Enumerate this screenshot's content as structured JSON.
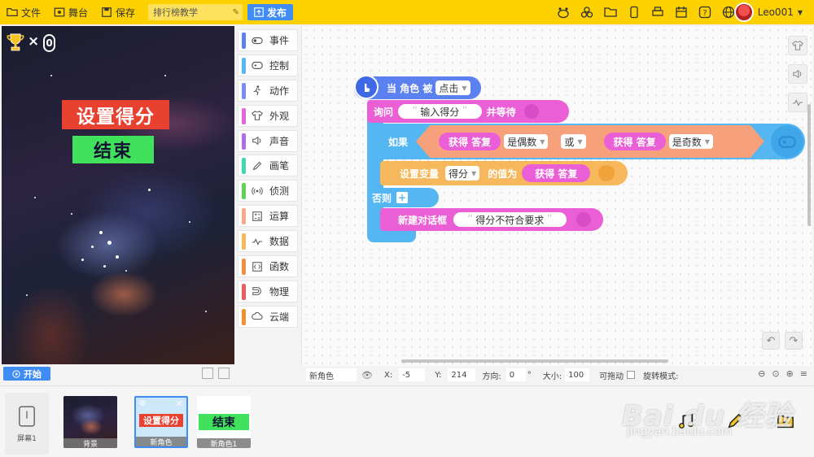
{
  "topbar": {
    "file_label": "文件",
    "stage_label": "舞台",
    "save_label": "保存",
    "project_name": "排行榜教学",
    "publish_label": "发布",
    "username": "Leo001",
    "bg_color": "#fdd000"
  },
  "stage": {
    "score_count": "0",
    "times_symbol": "×",
    "sprite_title": "设置得分",
    "sprite_end": "结束",
    "start_label": "开始"
  },
  "categories": [
    {
      "label": "事件",
      "color": "#5b80f0",
      "icon": "toggle-icon"
    },
    {
      "label": "控制",
      "color": "#55b7f2",
      "icon": "gamepad-icon"
    },
    {
      "label": "动作",
      "color": "#7a8df2",
      "icon": "runner-icon"
    },
    {
      "label": "外观",
      "color": "#e964d6",
      "icon": "shirt-icon"
    },
    {
      "label": "声音",
      "color": "#b16be8",
      "icon": "speaker-icon"
    },
    {
      "label": "画笔",
      "color": "#42d6b1",
      "icon": "pen-icon"
    },
    {
      "label": "侦测",
      "color": "#5ed456",
      "icon": "signal-icon"
    },
    {
      "label": "运算",
      "color": "#f7a98a",
      "icon": "calculator-icon"
    },
    {
      "label": "数据",
      "color": "#f6b85a",
      "icon": "data-icon"
    },
    {
      "label": "函数",
      "color": "#f2904a",
      "icon": "function-icon"
    },
    {
      "label": "物理",
      "color": "#f05b5b",
      "icon": "magnet-icon"
    },
    {
      "label": "云端",
      "color": "#f2902f",
      "icon": "cloud-icon"
    }
  ],
  "blocks": {
    "hat_label": "当 角色 被",
    "hat_dd": "点击",
    "ask_label": "询问",
    "ask_text": "输入得分",
    "ask_suffix": "并等待",
    "if_label": "如果",
    "get_answer_1": "获得 答复",
    "is_even": "是偶数",
    "or_label": "或",
    "get_answer_2": "获得 答复",
    "is_odd": "是奇数",
    "set_var_label": "设置变量",
    "var_name": "得分",
    "value_label": "的值为",
    "get_answer_3": "获得 答复",
    "else_label": "否则",
    "plus_symbol": "+",
    "dialog_label": "新建对话框",
    "dialog_text": "得分不符合要求",
    "colors": {
      "event": "#5b80f0",
      "look": "#ea5fd6",
      "control": "#55b7f2",
      "data": "#f6b85a"
    }
  },
  "props": {
    "sprite_name": "新角色",
    "x_label": "X:",
    "x_value": "-5",
    "y_label": "Y:",
    "y_value": "214",
    "dir_label": "方向:",
    "dir_value": "0",
    "deg_symbol": "°",
    "size_label": "大小:",
    "size_value": "100",
    "draggable_label": "可拖动",
    "rotate_label": "旋转模式:"
  },
  "strip": {
    "screen_label": "屏幕1",
    "bg_label": "背景",
    "sprite1_label": "新角色",
    "sprite1_text": "设置得分",
    "sprite2_label": "新角色1",
    "sprite2_text": "结束"
  },
  "watermark": {
    "main": "Bai du 经验",
    "sub": "jingyan.baidu.com"
  }
}
